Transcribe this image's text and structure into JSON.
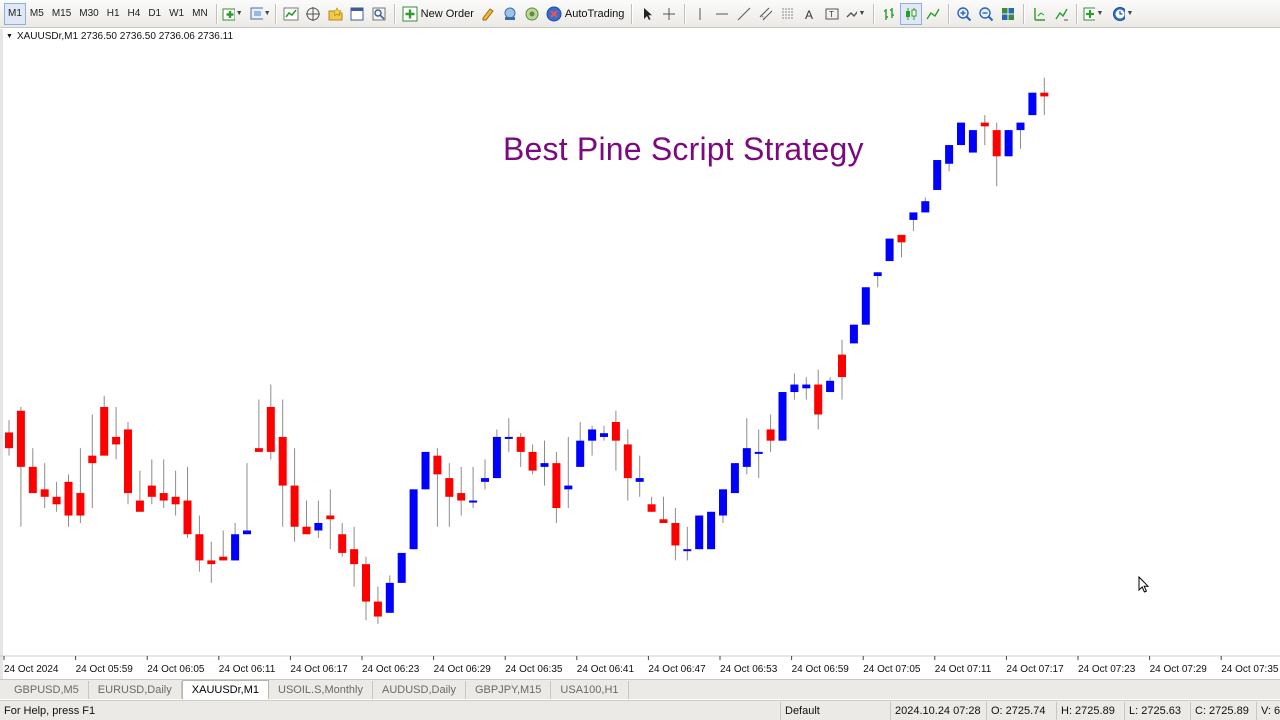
{
  "toolbar": {
    "timeframes": [
      "M1",
      "M5",
      "M15",
      "M30",
      "H1",
      "H4",
      "D1",
      "W1",
      "MN"
    ],
    "active_timeframe": "M1",
    "new_order_label": "New Order",
    "autotrading_label": "AutoTrading",
    "icons": [
      "new-chart-icon",
      "profiles-icon",
      "market-watch-icon",
      "navigator-icon",
      "data-window-icon",
      "terminal-icon",
      "strategy-tester-icon",
      "new-order-icon",
      "metaeditor-icon",
      "signals-icon",
      "market-icon",
      "autotrading-icon",
      "cursor-icon",
      "crosshair-icon",
      "vertical-line-icon",
      "horizontal-line-icon",
      "trendline-icon",
      "channel-icon",
      "fibonacci-icon",
      "text-icon",
      "text-label-icon",
      "arrows-icon",
      "bar-chart-icon",
      "candlestick-icon",
      "line-chart-icon",
      "zoom-in-icon",
      "zoom-out-icon",
      "tile-windows-icon",
      "chart-shift-icon",
      "autoscroll-icon",
      "indicators-icon",
      "periods-icon"
    ]
  },
  "chart": {
    "symbol_info": "XAUUSDr,M1  2736.50 2736.50 2736.06 2736.11",
    "strategy_title": "Best Pine Script Strategy",
    "time_labels": [
      "24 Oct 2024",
      "24 Oct 05:59",
      "24 Oct 06:05",
      "24 Oct 06:11",
      "24 Oct 06:17",
      "24 Oct 06:23",
      "24 Oct 06:29",
      "24 Oct 06:35",
      "24 Oct 06:41",
      "24 Oct 06:47",
      "24 Oct 06:53",
      "24 Oct 06:59",
      "24 Oct 07:05",
      "24 Oct 07:11",
      "24 Oct 07:17",
      "24 Oct 07:23",
      "24 Oct 07:29",
      "24 Oct 07:35"
    ],
    "colors": {
      "bull": "#0000ff",
      "bear": "#ff0000",
      "wick": "#8c8c8c",
      "title": "#7c0a7e"
    }
  },
  "tabs": {
    "items": [
      "GBPUSD,M5",
      "EURUSD,Daily",
      "XAUUSDr,M1",
      "USOIL.S,Monthly",
      "AUDUSD,Daily",
      "GBPJPY,M15",
      "USA100,H1"
    ],
    "active": "XAUUSDr,M1"
  },
  "statusbar": {
    "help": "For Help, press F1",
    "profile": "Default",
    "datetime": "2024.10.24 07:28",
    "open": "O: 2725.74",
    "high": "H: 2725.89",
    "low": "L: 2725.63",
    "close": "C: 2725.89",
    "volume": "V: 61"
  },
  "chart_data": {
    "type": "candlestick",
    "x": [
      "24 Oct 2024",
      "24 Oct 05:59",
      "24 Oct 06:05",
      "24 Oct 06:11",
      "24 Oct 06:17",
      "24 Oct 06:23",
      "24 Oct 06:29",
      "24 Oct 06:35",
      "24 Oct 06:41",
      "24 Oct 06:47",
      "24 Oct 06:53",
      "24 Oct 06:59",
      "24 Oct 07:05",
      "24 Oct 07:11",
      "24 Oct 07:17",
      "24 Oct 07:23",
      "24 Oct 07:29",
      "24 Oct 07:35"
    ],
    "ylim": [
      0,
      100
    ],
    "grid": false,
    "candles": [
      [
        75.2,
        78.5,
        71,
        69
      ],
      [
        81,
        82,
        66,
        50
      ],
      [
        66,
        71,
        59,
        64
      ],
      [
        60,
        67,
        58,
        55
      ],
      [
        58,
        62,
        56,
        54
      ],
      [
        62,
        64,
        53,
        50
      ],
      [
        59,
        71,
        53,
        51
      ],
      [
        69,
        80,
        67,
        55
      ],
      [
        82,
        85,
        69,
        70
      ],
      [
        74,
        82,
        72,
        68
      ],
      [
        76,
        78,
        59,
        56
      ],
      [
        57,
        65,
        54,
        55
      ],
      [
        61,
        68,
        58,
        56
      ],
      [
        59,
        68,
        57,
        55
      ],
      [
        58,
        65,
        56,
        53
      ],
      [
        57,
        66,
        48,
        47
      ],
      [
        48,
        53,
        41,
        38
      ],
      [
        41,
        46,
        40,
        35
      ],
      [
        42,
        49,
        41,
        41
      ],
      [
        41,
        51,
        48,
        45
      ],
      [
        48,
        67,
        49,
        48
      ],
      [
        71,
        84,
        70,
        70
      ],
      [
        82,
        88,
        70,
        68
      ],
      [
        74,
        84,
        61,
        50
      ],
      [
        61,
        71,
        50,
        46
      ],
      [
        50,
        57,
        48,
        48
      ],
      [
        49,
        57,
        51,
        47
      ],
      [
        53,
        60,
        52,
        44
      ],
      [
        48,
        51,
        43,
        42
      ],
      [
        44,
        50,
        40,
        34
      ],
      [
        40,
        42,
        30,
        25
      ],
      [
        30,
        34,
        26,
        24
      ],
      [
        27,
        37,
        35,
        32
      ],
      [
        35,
        42,
        43,
        39
      ],
      [
        44,
        52,
        60,
        47
      ],
      [
        60,
        64,
        70,
        63
      ],
      [
        69,
        71,
        64,
        50
      ],
      [
        63,
        67,
        58,
        50
      ],
      [
        59,
        66,
        57,
        53
      ],
      [
        57,
        66,
        57,
        55
      ],
      [
        62,
        68,
        63,
        60
      ],
      [
        63,
        76,
        74,
        68
      ],
      [
        74,
        79,
        74,
        70
      ],
      [
        74,
        75,
        70,
        66
      ],
      [
        70,
        72,
        65,
        64
      ],
      [
        66,
        73,
        67,
        61
      ],
      [
        67,
        70,
        55,
        51
      ],
      [
        60,
        74,
        61,
        55
      ],
      [
        66,
        78,
        73,
        67
      ],
      [
        73,
        77,
        76,
        69
      ],
      [
        74,
        77,
        75,
        73
      ],
      [
        78,
        81,
        73,
        65
      ],
      [
        72,
        76,
        63,
        57
      ],
      [
        62,
        69,
        63,
        58
      ],
      [
        56,
        58,
        54,
        56
      ],
      [
        52,
        58,
        51,
        53
      ],
      [
        51,
        55,
        45,
        41
      ],
      [
        44,
        50,
        44,
        41
      ],
      [
        44,
        48,
        53,
        48
      ],
      [
        44,
        54,
        54,
        52
      ],
      [
        53,
        59,
        60,
        51
      ],
      [
        59,
        67,
        67,
        59
      ],
      [
        66,
        79,
        71,
        64
      ],
      [
        70,
        76,
        70,
        63
      ],
      [
        76,
        80,
        73,
        70
      ],
      [
        73,
        84,
        86,
        79
      ],
      [
        86,
        91,
        88,
        84
      ],
      [
        87,
        90,
        88,
        84
      ],
      [
        88,
        92,
        80,
        76
      ],
      [
        86,
        90,
        89,
        86
      ],
      [
        96,
        100,
        90,
        84
      ],
      [
        99,
        104,
        104,
        100
      ],
      [
        104,
        114,
        114,
        109
      ],
      [
        117,
        118,
        118,
        114
      ],
      [
        121,
        125,
        127,
        122
      ],
      [
        128,
        128,
        126,
        122
      ],
      [
        132,
        133,
        134,
        129
      ],
      [
        134,
        138,
        137,
        134
      ],
      [
        140,
        143,
        148,
        143
      ],
      [
        147,
        149,
        152,
        145
      ],
      [
        152,
        157,
        158,
        154
      ],
      [
        150,
        154,
        156,
        152
      ],
      [
        158,
        160,
        157,
        152
      ],
      [
        156,
        158,
        149,
        141
      ],
      [
        149,
        153,
        156,
        149
      ],
      [
        156,
        158,
        158,
        151
      ],
      [
        160,
        166,
        166,
        160
      ],
      [
        166,
        170,
        165,
        160
      ]
    ]
  }
}
